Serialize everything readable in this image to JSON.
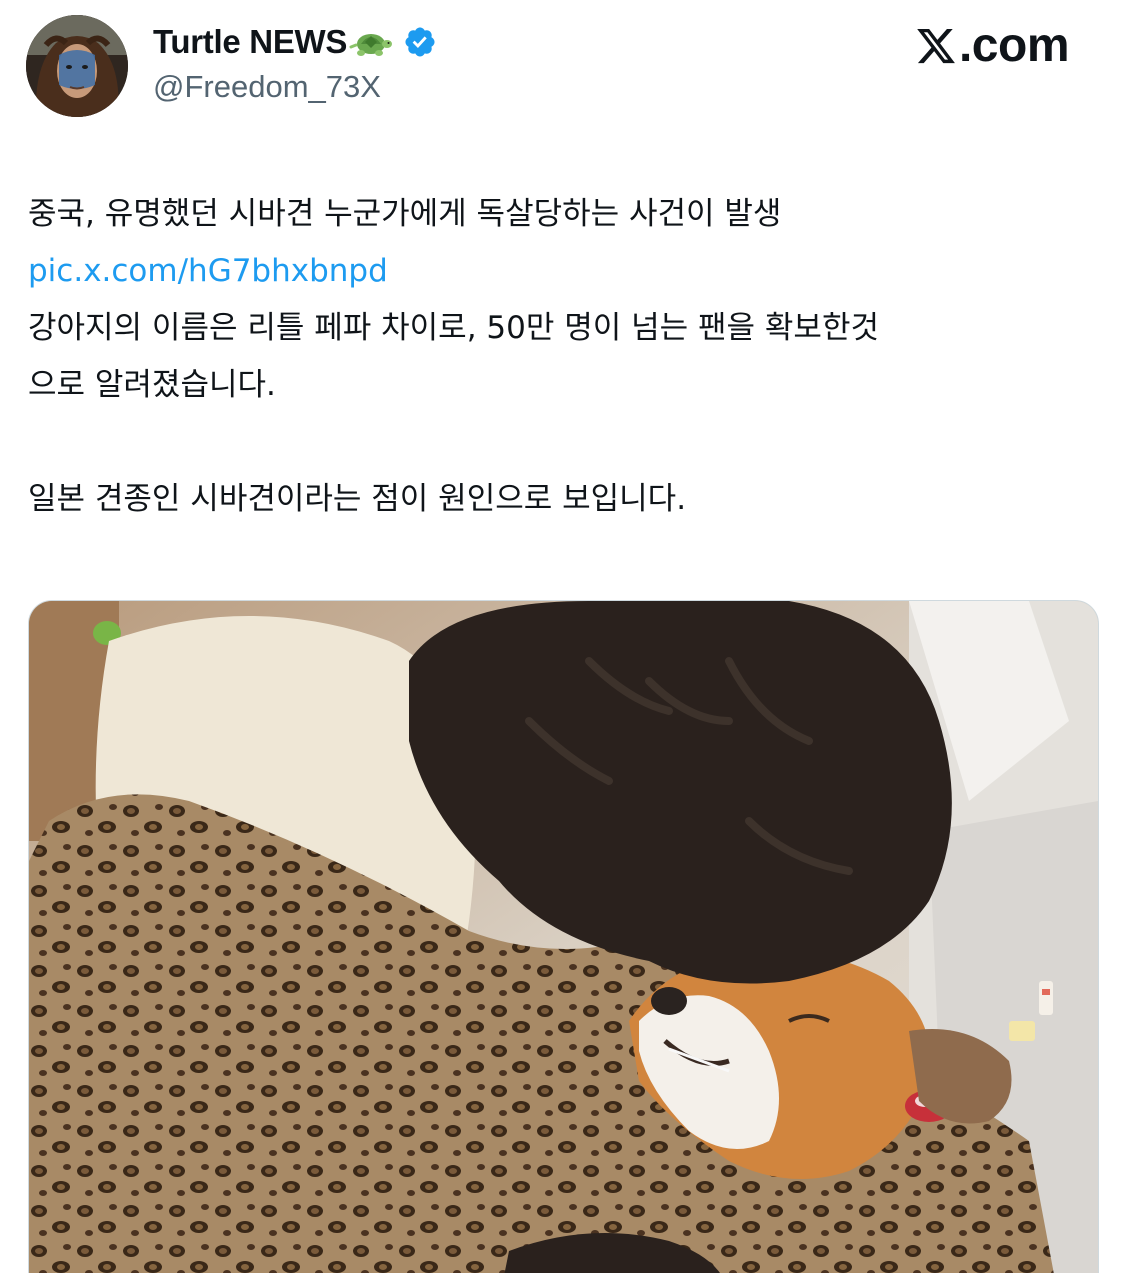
{
  "header": {
    "display_name": "Turtle NEWS",
    "handle": "@Freedom_73X",
    "verified": true,
    "name_emoji_icon": "turtle-icon",
    "verified_icon": "verified-badge-icon"
  },
  "branding": {
    "site_label": ".com",
    "logo_icon": "x-logo-icon"
  },
  "tweet": {
    "line1": "중국, 유명했던 시바견 누군가에게 독살당하는 사건이 발생",
    "link": "pic.x.com/hG7bhxbnpd",
    "line3": "강아지의 이름은 리틀 페파 차이로, 50만 명이 넘는 팬을 확보한것",
    "line4": "으로 알려졌습니다.",
    "line5": "일본 견종인 시바견이라는 점이 원인으로 보입니다."
  },
  "media": {
    "kind": "photo",
    "subject": "dog-photo"
  },
  "colors": {
    "text": "#0f1419",
    "secondary": "#536471",
    "link": "#1d9bf0",
    "verified": "#1d9bf0"
  }
}
